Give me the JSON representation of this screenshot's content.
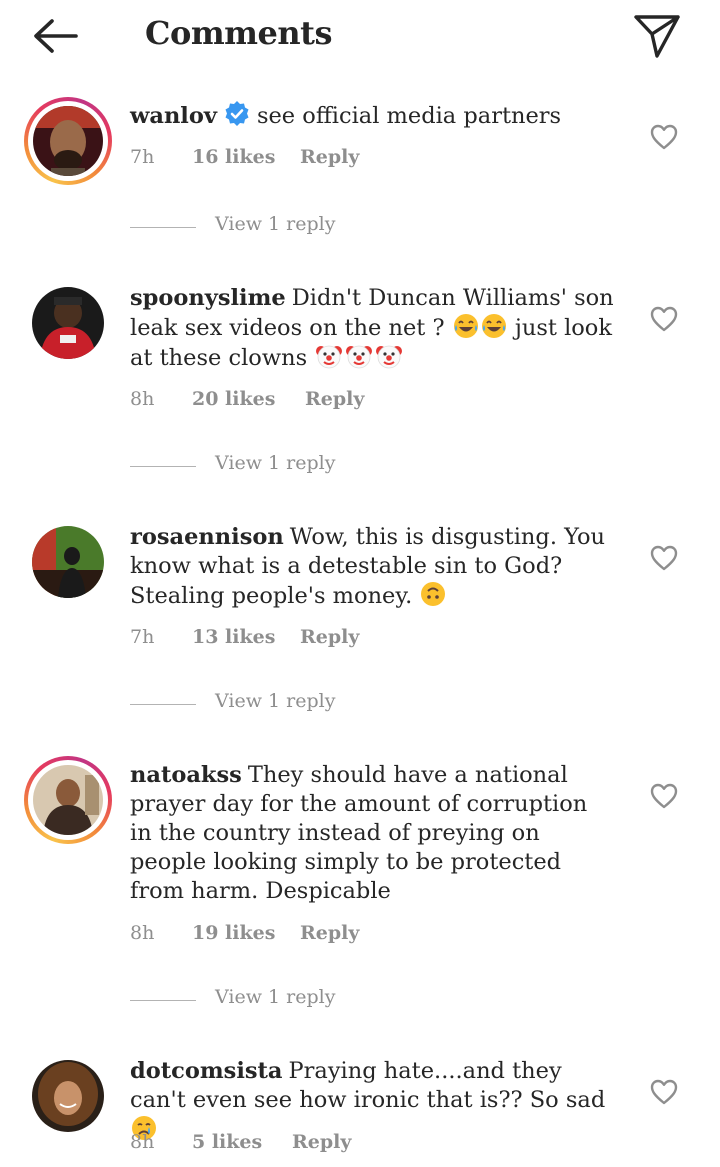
{
  "header": {
    "title": "Comments",
    "back_icon": "arrow-left-icon",
    "share_icon": "send-icon"
  },
  "colors": {
    "text": "#262626",
    "secondary": "#8e8e8e",
    "verified": "#3897f0",
    "story_ring": [
      "#f9c34b",
      "#e53a5f",
      "#c13584"
    ]
  },
  "comments": [
    {
      "username": "wanlov",
      "verified": true,
      "story_ring": true,
      "text": "see official media partners",
      "time": "7h",
      "likes": "16 likes",
      "reply": "Reply",
      "view_replies": "View 1 reply"
    },
    {
      "username": "spoonyslime",
      "verified": false,
      "story_ring": false,
      "text": "Didn't Duncan Williams' son leak sex videos on the net ?",
      "text_2": "just look at these clowns",
      "emojis_1": [
        "face-with-tears-of-joy",
        "face-with-tears-of-joy"
      ],
      "emojis_2": [
        "clown-face",
        "clown-face",
        "clown-face"
      ],
      "time": "8h",
      "likes": "20 likes",
      "reply": "Reply",
      "view_replies": "View 1 reply"
    },
    {
      "username": "rosaennison",
      "verified": false,
      "story_ring": false,
      "text": "Wow, this is disgusting. You know what is a detestable sin to God? Stealing people's money.",
      "emojis_1": [
        "upside-down-face"
      ],
      "time": "7h",
      "likes": "13 likes",
      "reply": "Reply",
      "view_replies": "View 1 reply"
    },
    {
      "username": "natoakss",
      "verified": false,
      "story_ring": true,
      "text": "They should have a national prayer day for the amount of corruption in the country instead of preying on people looking simply to be protected from harm. Despicable",
      "time": "8h",
      "likes": "19 likes",
      "reply": "Reply",
      "view_replies": "View 1 reply"
    },
    {
      "username": "dotcomsista",
      "verified": false,
      "story_ring": false,
      "text": "Praying hate....and they can't even see how ironic that is?? So sad",
      "emojis_1": [
        "crying-face"
      ],
      "time": "8h",
      "likes": "5 likes",
      "reply": "Reply"
    }
  ]
}
